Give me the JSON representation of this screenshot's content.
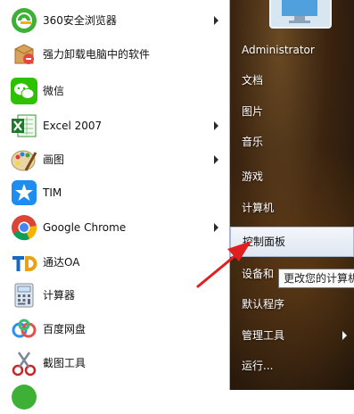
{
  "start_menu": {
    "programs": [
      {
        "label": "360安全浏览器",
        "icon": "360-browser-icon",
        "submenu": true
      },
      {
        "label": "强力卸载电脑中的软件",
        "icon": "uninstall-icon",
        "submenu": false
      },
      {
        "label": "微信",
        "icon": "wechat-icon",
        "submenu": false
      },
      {
        "label": "Excel 2007",
        "icon": "excel-icon",
        "submenu": true
      },
      {
        "label": "画图",
        "icon": "paint-icon",
        "submenu": true
      },
      {
        "label": "TIM",
        "icon": "tim-icon",
        "submenu": false
      },
      {
        "label": "Google Chrome",
        "icon": "chrome-icon",
        "submenu": true
      },
      {
        "label": "通达OA",
        "icon": "tongda-oa-icon",
        "submenu": false
      },
      {
        "label": "计算器",
        "icon": "calculator-icon",
        "submenu": false
      },
      {
        "label": "百度网盘",
        "icon": "baidu-netdisk-icon",
        "submenu": false
      },
      {
        "label": "截图工具",
        "icon": "snipping-tool-icon",
        "submenu": false
      }
    ],
    "right_items": [
      {
        "label": "Administrator"
      },
      {
        "label": "文档"
      },
      {
        "label": "图片"
      },
      {
        "label": "音乐"
      },
      {
        "label": "游戏"
      },
      {
        "label": "计算机"
      },
      {
        "label": "控制面板"
      },
      {
        "label": "设备和"
      },
      {
        "label": "默认程序"
      },
      {
        "label": "管理工具"
      },
      {
        "label": "运行..."
      }
    ],
    "tooltip": "更改您的计算机",
    "colors": {
      "highlight": "#dfe7f1",
      "red_arrow": "#e02020",
      "right_panel": "#3b2410"
    }
  }
}
